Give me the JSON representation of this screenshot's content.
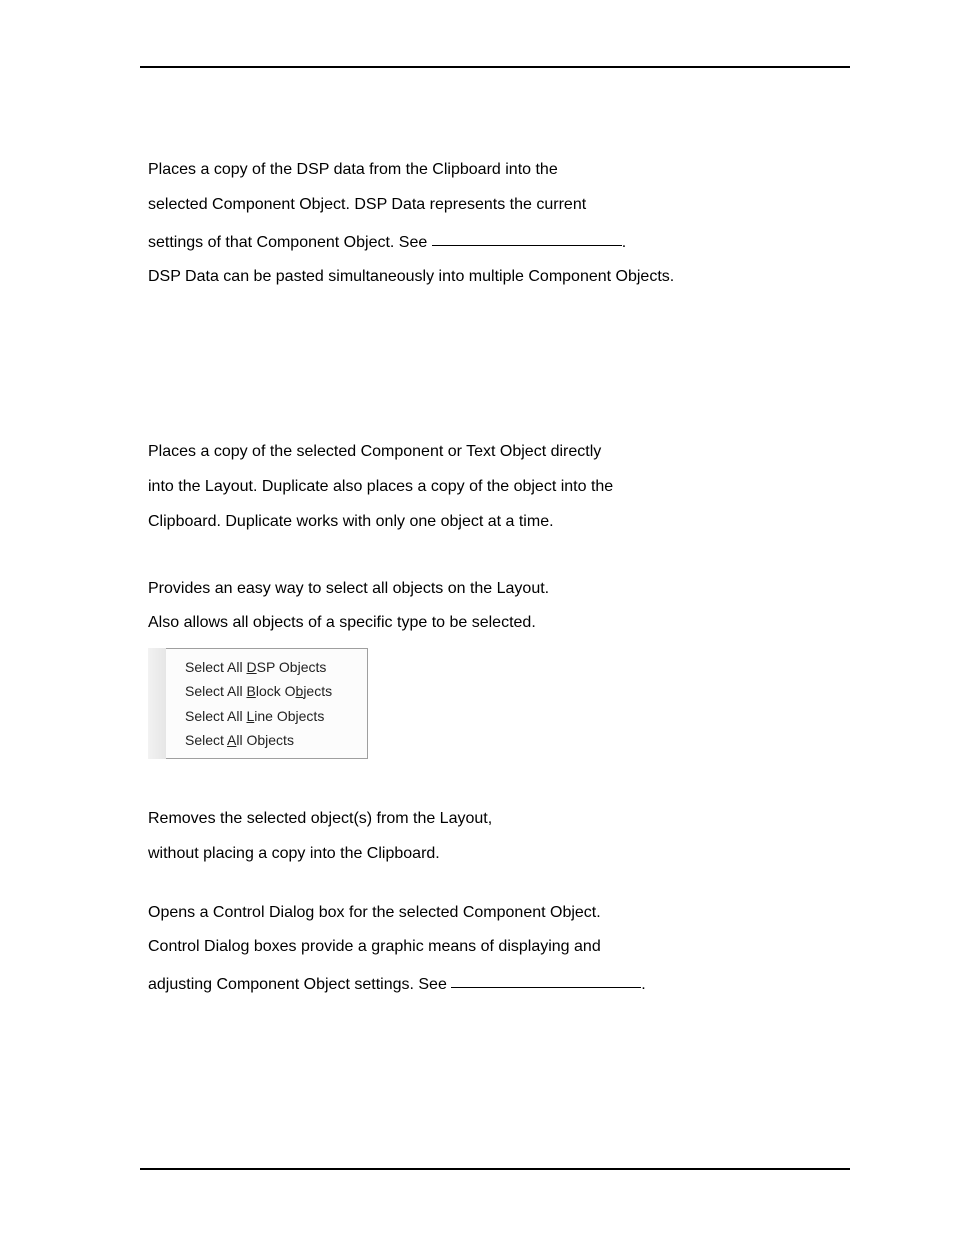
{
  "paste": {
    "l1": "Places a copy of the DSP data from the Clipboard into the",
    "l2": "selected Component Object. DSP Data represents the current",
    "l3a": "settings of that Component Object. See ",
    "l3b": ".",
    "l4": "DSP Data can be pasted simultaneously into multiple Component Objects."
  },
  "duplicate": {
    "l1": "Places a copy of the selected Component or Text Object directly",
    "l2": "into the Layout. Duplicate also places a copy of the object into the",
    "l3": "Clipboard. Duplicate works with only one object at a time."
  },
  "select": {
    "l1": "Provides an easy way to select all objects on the Layout.",
    "l2": "Also allows all objects of a specific type to be selected."
  },
  "menu": {
    "dsp_pre": "Select All ",
    "dsp_u": "D",
    "dsp_post": "SP Objects",
    "block_pre": "Select All ",
    "block_u": "B",
    "block_mid": "lock O",
    "block_u2": "b",
    "block_post": "jects",
    "line_pre": "Select All ",
    "line_u": "L",
    "line_post": "ine Objects",
    "all_pre": "Select ",
    "all_u": "A",
    "all_post": "ll Objects"
  },
  "delete": {
    "l1": "Removes the selected object(s) from the Layout,",
    "l2": "without placing a copy into the Clipboard."
  },
  "control": {
    "l1": "Opens a Control Dialog box for the selected Component Object.",
    "l2": "Control Dialog boxes provide a graphic means of displaying and",
    "l3a": "adjusting Component Object settings. See ",
    "l3b": "."
  }
}
